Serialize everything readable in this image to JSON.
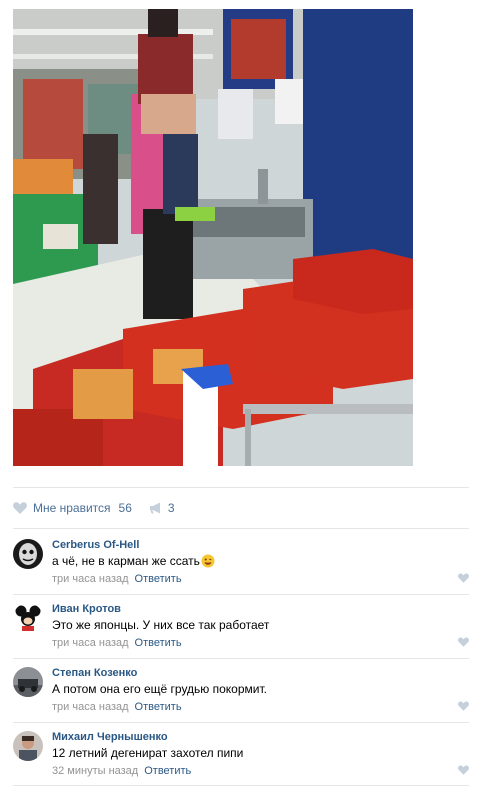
{
  "post": {
    "image_alt": "",
    "likes": {
      "label": "Мне нравится",
      "count": "56"
    },
    "shares": {
      "count": "3"
    }
  },
  "comments": [
    {
      "author": "Cerberus Of-Hell",
      "text": "а чё, не в карман же ссать",
      "emoji": "grinning-face-emoji",
      "time": "три часа назад",
      "reply": "Ответить"
    },
    {
      "author": "Иван Кротов",
      "text": "Это же японцы. У них все так работает",
      "time": "три часа назад",
      "reply": "Ответить"
    },
    {
      "author": "Степан Козенко",
      "text": "А потом она его ещё грудью покормит.",
      "time": "три часа назад",
      "reply": "Ответить"
    },
    {
      "author": "Михаил Чернышенко",
      "text": "12 летний дегенират захотел пипи",
      "time": "32 минуты назад",
      "reply": "Ответить"
    }
  ],
  "icons": {
    "like": "heart-icon",
    "share": "megaphone-icon"
  },
  "colors": {
    "link": "#2a5885",
    "action": "#4a6f97",
    "muted": "#939393",
    "icon": "#c5d0db"
  }
}
